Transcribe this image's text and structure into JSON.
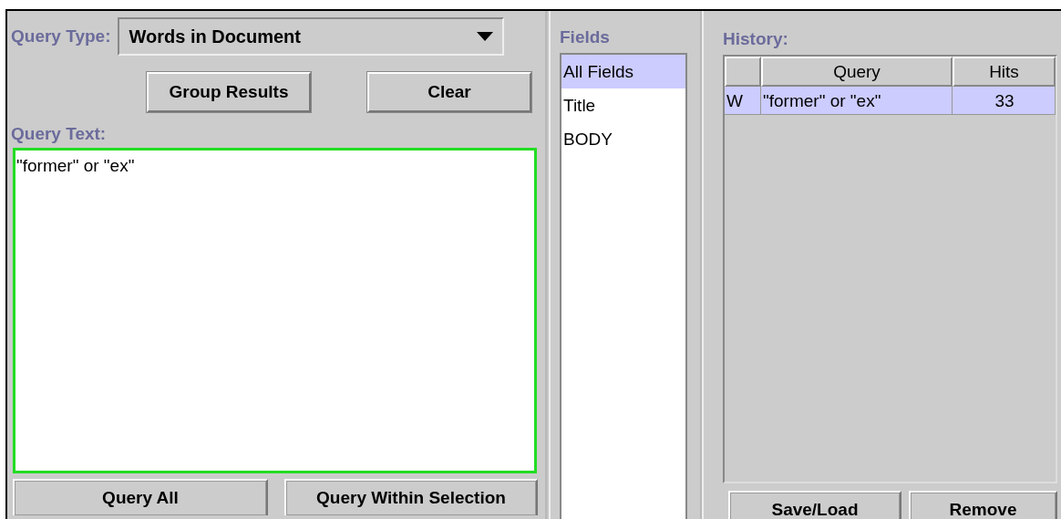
{
  "query_panel": {
    "query_type_label": "Query Type:",
    "query_type": "Words in Document",
    "buttons_top": [
      "Group Results",
      "Clear"
    ],
    "query_text_label": "Query Text:",
    "query_text": {
      "value": "\"former\" or \"ex\"",
      "focused": true
    },
    "buttons_bottom": [
      "Query All",
      "Query Within Selection"
    ]
  },
  "fields": {
    "label": "Fields",
    "items": [
      {
        "label": "All Fields",
        "selected": true
      },
      {
        "label": "Title",
        "selected": false
      },
      {
        "label": "BODY",
        "selected": false
      }
    ]
  },
  "history": {
    "label": "History:",
    "columns": [
      "Query",
      "Hits"
    ],
    "rows": [
      {
        "type": "W",
        "query": "\"former\" or \"ex\"",
        "hits": "33",
        "selected": true
      }
    ],
    "buttons": [
      "Save/Load",
      "Remove"
    ]
  }
}
